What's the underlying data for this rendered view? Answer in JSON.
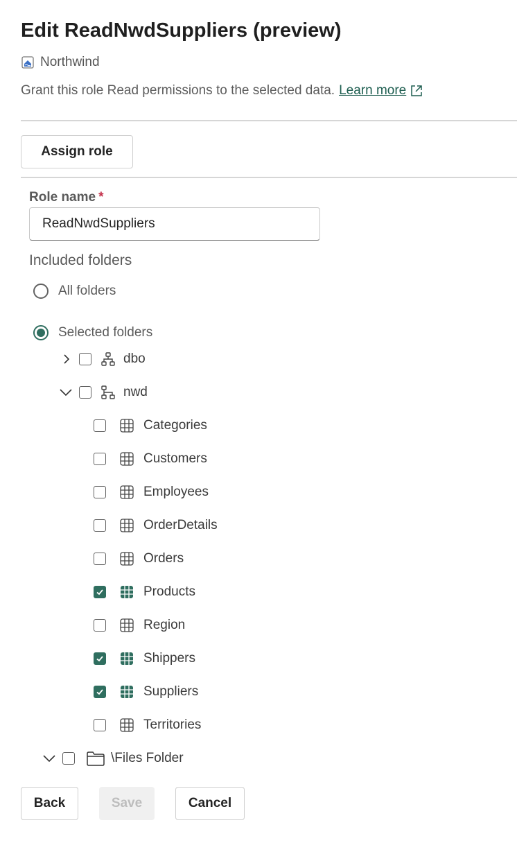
{
  "header": {
    "title": "Edit ReadNwdSuppliers (preview)",
    "workspace": "Northwind",
    "description": "Grant this role Read permissions to the selected data.",
    "learn_more": "Learn more"
  },
  "toolbar": {
    "assign_role": "Assign role"
  },
  "form": {
    "role_label": "Role name",
    "required_mark": "*",
    "role_value": "ReadNwdSuppliers",
    "included_label": "Included folders",
    "all_folders": "All folders",
    "selected_folders": "Selected folders"
  },
  "tree": {
    "dbo": "dbo",
    "nwd": "nwd",
    "tables": [
      {
        "name": "Categories",
        "checked": false
      },
      {
        "name": "Customers",
        "checked": false
      },
      {
        "name": "Employees",
        "checked": false
      },
      {
        "name": "OrderDetails",
        "checked": false
      },
      {
        "name": "Orders",
        "checked": false
      },
      {
        "name": "Products",
        "checked": true
      },
      {
        "name": "Region",
        "checked": false
      },
      {
        "name": "Shippers",
        "checked": true
      },
      {
        "name": "Suppliers",
        "checked": true
      },
      {
        "name": "Territories",
        "checked": false
      }
    ],
    "files_folder": "\\Files Folder"
  },
  "footer": {
    "back": "Back",
    "save": "Save",
    "cancel": "Cancel"
  },
  "colors": {
    "accent": "#2f6e5f",
    "link": "#1e5e50"
  }
}
